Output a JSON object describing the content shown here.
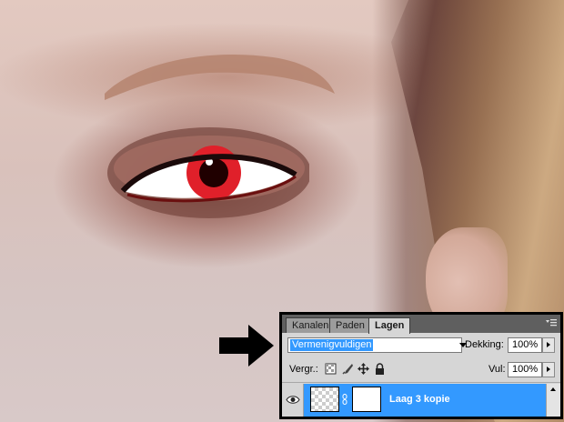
{
  "panel": {
    "tabs": [
      {
        "label": "Kanalen",
        "active": false
      },
      {
        "label": "Paden",
        "active": false
      },
      {
        "label": "Lagen",
        "active": true
      }
    ],
    "blend_mode": "Vermenigvuldigen",
    "opacity_label": "Dekking:",
    "opacity_value": "100%",
    "lock_label": "Vergr.:",
    "fill_label": "Vul:",
    "fill_value": "100%",
    "layer": {
      "name": "Laag 3 kopie",
      "visible": true,
      "selected": true
    },
    "selection_color": "#3399ff"
  },
  "icons": [
    "eye-icon",
    "lock-transparent-icon",
    "lock-paint-icon",
    "lock-move-icon",
    "lock-all-icon",
    "link-icon",
    "panel-menu-icon"
  ],
  "photo": {
    "subject": "",
    "eye_color": "#e0202a"
  }
}
